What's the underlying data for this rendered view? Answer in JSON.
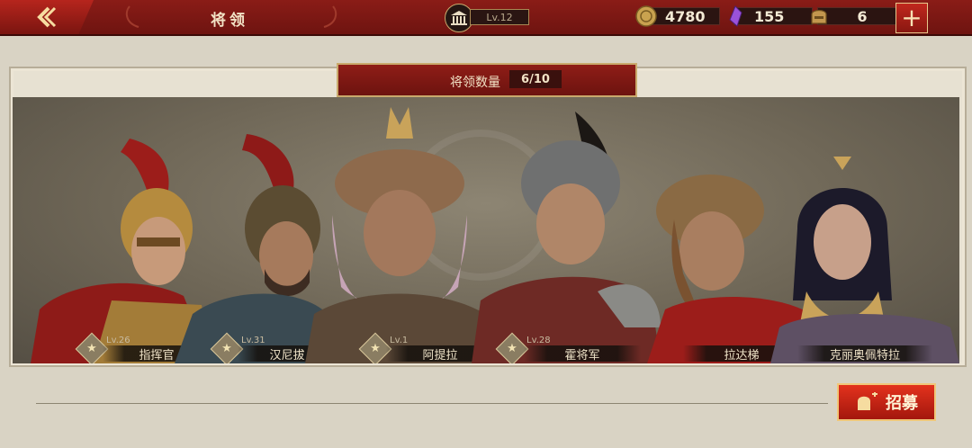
{
  "header": {
    "title": "将领",
    "level": "Lv.12",
    "coins": "4780",
    "gems": "155",
    "tokens": "6",
    "add_symbol": "+"
  },
  "roster": {
    "count_label": "将领数量",
    "count_value": "6/10"
  },
  "generals": [
    {
      "name": "指挥官",
      "level": "Lv.26"
    },
    {
      "name": "汉尼拔",
      "level": "Lv.31"
    },
    {
      "name": "阿提拉",
      "level": "Lv.1"
    },
    {
      "name": "霍将军",
      "level": "Lv.28"
    },
    {
      "name": "拉达梯",
      "level": ""
    },
    {
      "name": "克丽奥佩特拉",
      "level": ""
    }
  ],
  "recruit": {
    "label": "招募"
  },
  "colors": {
    "brand_red": "#8a1c17",
    "gold": "#c9a96c",
    "parchment": "#d9d3c4"
  }
}
